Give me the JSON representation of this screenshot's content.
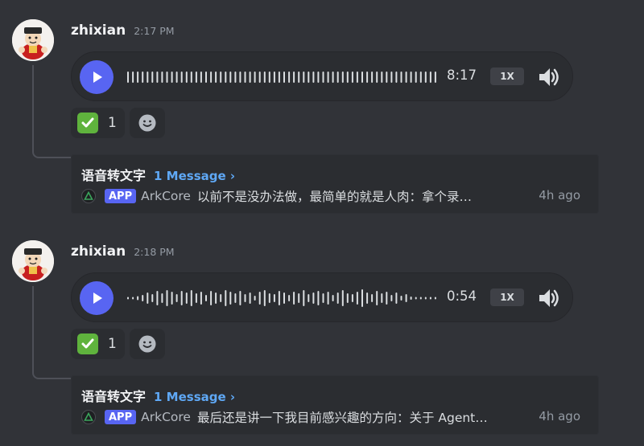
{
  "colors": {
    "background": "#313338",
    "accent": "#5865f2",
    "check": "#5fb33d",
    "link": "#5fa8f5"
  },
  "messages": [
    {
      "username": "zhixian",
      "time": "2:17 PM",
      "duration": "8:17",
      "speed": "1X",
      "reaction_count": "1",
      "thread_name": "语音转文字",
      "thread_count": "1 Message ›",
      "app_badge": "APP",
      "preview_author": "ArkCore",
      "preview_text": "以前不是没办法做，最简单的就是人肉：拿个录…",
      "preview_time": "4h ago",
      "icons": {
        "play": "play-icon",
        "volume": "volume-icon",
        "reaction": "check-mark-emoji",
        "add_reaction": "smile-icon"
      }
    },
    {
      "username": "zhixian",
      "time": "2:18 PM",
      "duration": "0:54",
      "speed": "1X",
      "reaction_count": "1",
      "thread_name": "语音转文字",
      "thread_count": "1 Message ›",
      "app_badge": "APP",
      "preview_author": "ArkCore",
      "preview_text": "最后还是讲一下我目前感兴趣的方向：关于 Agent…",
      "preview_time": "4h ago",
      "icons": {
        "play": "play-icon",
        "volume": "volume-icon",
        "reaction": "check-mark-emoji",
        "add_reaction": "smile-icon"
      }
    }
  ]
}
